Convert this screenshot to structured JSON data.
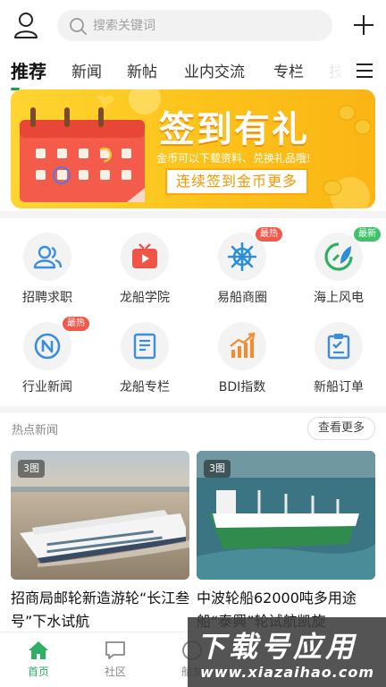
{
  "search": {
    "placeholder": "搜索关键词"
  },
  "tabs": [
    "推荐",
    "新闻",
    "新帖",
    "业内交流",
    "专栏",
    "技"
  ],
  "banner": {
    "title": "签到有礼",
    "subtitle": "金币可以下载资料、兑换礼品哦!",
    "button": "连续签到金币更多"
  },
  "grid": [
    {
      "label": "招聘求职",
      "icon": "people-icon"
    },
    {
      "label": "龙船学院",
      "icon": "tv-icon"
    },
    {
      "label": "易船商圈",
      "icon": "ship-wheel-icon",
      "badge": "最热"
    },
    {
      "label": "海上风电",
      "icon": "wind-leaf-icon",
      "badge": "最新"
    },
    {
      "label": "行业新闻",
      "icon": "compass-n-icon",
      "badge": "最热"
    },
    {
      "label": "龙船专栏",
      "icon": "document-icon"
    },
    {
      "label": "BDI指数",
      "icon": "bar-chart-icon"
    },
    {
      "label": "新船订单",
      "icon": "clipboard-check-icon"
    }
  ],
  "hot_news": {
    "title": "热点新闻",
    "more": "查看更多",
    "articles": [
      {
        "count": "3图",
        "title": "招商局邮轮新造游轮“长江叁号”下水试航"
      },
      {
        "count": "3图",
        "title": "中波轮船62000吨多用途船“泰興”轮试航凯旋"
      }
    ]
  },
  "bottom_nav": [
    {
      "label": "首页",
      "icon": "home-icon"
    },
    {
      "label": "社区",
      "icon": "chat-icon"
    },
    {
      "label": "船友",
      "icon": "contacts-icon"
    }
  ],
  "watermark": {
    "main": "下载号应用",
    "sub": "www.xiazaihao.com"
  },
  "colors": {
    "accent": "#2fae66",
    "hot": "#ef5a4d",
    "new": "#40c26d",
    "banner": "#fcc21a"
  }
}
